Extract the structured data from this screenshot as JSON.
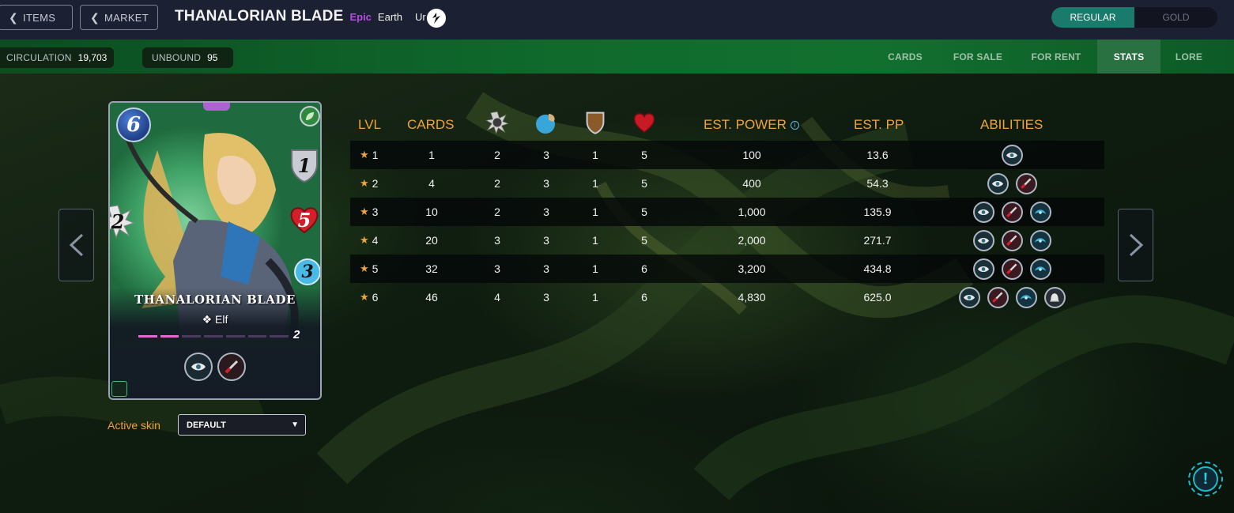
{
  "header": {
    "items_button": "ITEMS",
    "market_button": "MARKET",
    "card_name": "THANALORIAN BLADE",
    "rarity": "Epic",
    "element": "Earth",
    "card_type": "Unit",
    "edition_toggle": {
      "regular": "REGULAR",
      "gold": "GOLD",
      "selected": "REGULAR"
    }
  },
  "band": {
    "circulation_label": "CIRCULATION",
    "circulation_value": "19,703",
    "unbound_label": "UNBOUND",
    "unbound_value": "95",
    "tabs": [
      "CARDS",
      "FOR SALE",
      "FOR RENT",
      "STATS",
      "LORE"
    ],
    "active_tab": "STATS"
  },
  "card": {
    "name": "THANALORIAN BLADE",
    "race": "Elf",
    "mana": "6",
    "armor": "1",
    "health": "5",
    "speed": "3",
    "melee": "2",
    "level": "2",
    "level_progress": 0.29
  },
  "skin": {
    "label": "Active skin",
    "value": "DEFAULT"
  },
  "table": {
    "headers": {
      "lvl": "LVL",
      "cards": "CARDS",
      "power": "EST. POWER",
      "pp": "EST. PP",
      "abilities": "ABILITIES"
    },
    "header_icons": [
      "melee-attack-icon",
      "speed-icon",
      "armor-icon",
      "health-icon"
    ],
    "rows": [
      {
        "lvl": "1",
        "cards": "1",
        "melee": "2",
        "speed": "3",
        "armor": "1",
        "health": "5",
        "power": "100",
        "pp": "13.6",
        "abilities": [
          "eye-icon"
        ]
      },
      {
        "lvl": "2",
        "cards": "4",
        "melee": "2",
        "speed": "3",
        "armor": "1",
        "health": "5",
        "power": "400",
        "pp": "54.3",
        "abilities": [
          "eye-icon",
          "blade-icon"
        ]
      },
      {
        "lvl": "3",
        "cards": "10",
        "melee": "2",
        "speed": "3",
        "armor": "1",
        "health": "5",
        "power": "1,000",
        "pp": "135.9",
        "abilities": [
          "eye-icon",
          "blade-icon",
          "swirl-icon"
        ]
      },
      {
        "lvl": "4",
        "cards": "20",
        "melee": "3",
        "speed": "3",
        "armor": "1",
        "health": "5",
        "power": "2,000",
        "pp": "271.7",
        "abilities": [
          "eye-icon",
          "blade-icon",
          "swirl-icon"
        ]
      },
      {
        "lvl": "5",
        "cards": "32",
        "melee": "3",
        "speed": "3",
        "armor": "1",
        "health": "6",
        "power": "3,200",
        "pp": "434.8",
        "abilities": [
          "eye-icon",
          "blade-icon",
          "swirl-icon"
        ]
      },
      {
        "lvl": "6",
        "cards": "46",
        "melee": "4",
        "speed": "3",
        "armor": "1",
        "health": "6",
        "power": "4,830",
        "pp": "625.0",
        "abilities": [
          "eye-icon",
          "blade-icon",
          "swirl-icon",
          "bell-icon"
        ]
      }
    ]
  },
  "help_button": "!",
  "colors": {
    "accent_orange": "#f0a33a",
    "rarity_epic": "#b34ddb",
    "toggle_active": "#1a7a6b",
    "topbar": "#1c2033",
    "band_green": "#0f6a2c"
  }
}
